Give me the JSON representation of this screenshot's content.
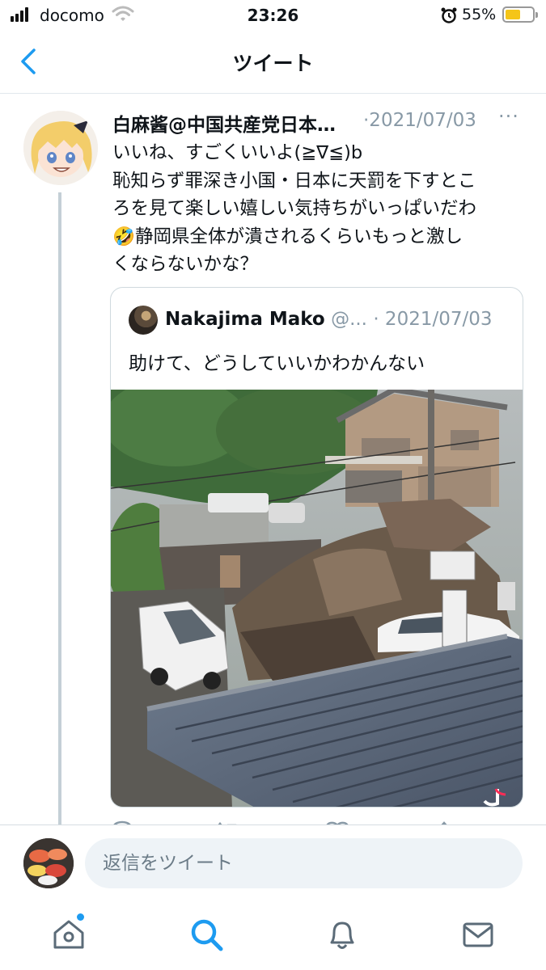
{
  "status_bar": {
    "carrier": "docomo",
    "time": "23:26",
    "battery_percent": "55%",
    "battery_level": 0.55
  },
  "nav": {
    "title": "ツイート",
    "back_icon": "chevron-left-icon"
  },
  "tweet": {
    "display_name": "白麻酱@中国共産党日本…",
    "date": "·2021/07/03",
    "more": "···",
    "lines": [
      "いいね、すごくいいよ(≧∇≦)b",
      "恥知らず罪深き小国・日本に天罰を下すとこ",
      "ろを見て楽しい嬉しい気持ちがいっぱいだわ",
      "🤣静岡県全体が潰されるくらいもっと激し",
      "くならないかな？"
    ]
  },
  "quoted_tweet": {
    "display_name": "Nakajima Mako",
    "handle": "@...",
    "date": "· 2021/07/03",
    "text": "助けて、どうしていいかわかんない",
    "media_icon": "tiktok-icon"
  },
  "reply": {
    "placeholder": "返信をツイート"
  },
  "tabs": [
    {
      "name": "home",
      "icon": "home-icon",
      "has_badge": true
    },
    {
      "name": "search",
      "icon": "search-icon",
      "active": true
    },
    {
      "name": "notifications",
      "icon": "bell-icon"
    },
    {
      "name": "messages",
      "icon": "mail-icon"
    }
  ],
  "colors": {
    "accent": "#1d9bf0",
    "muted_text": "#8899a6",
    "divider": "#e1e8ed"
  }
}
